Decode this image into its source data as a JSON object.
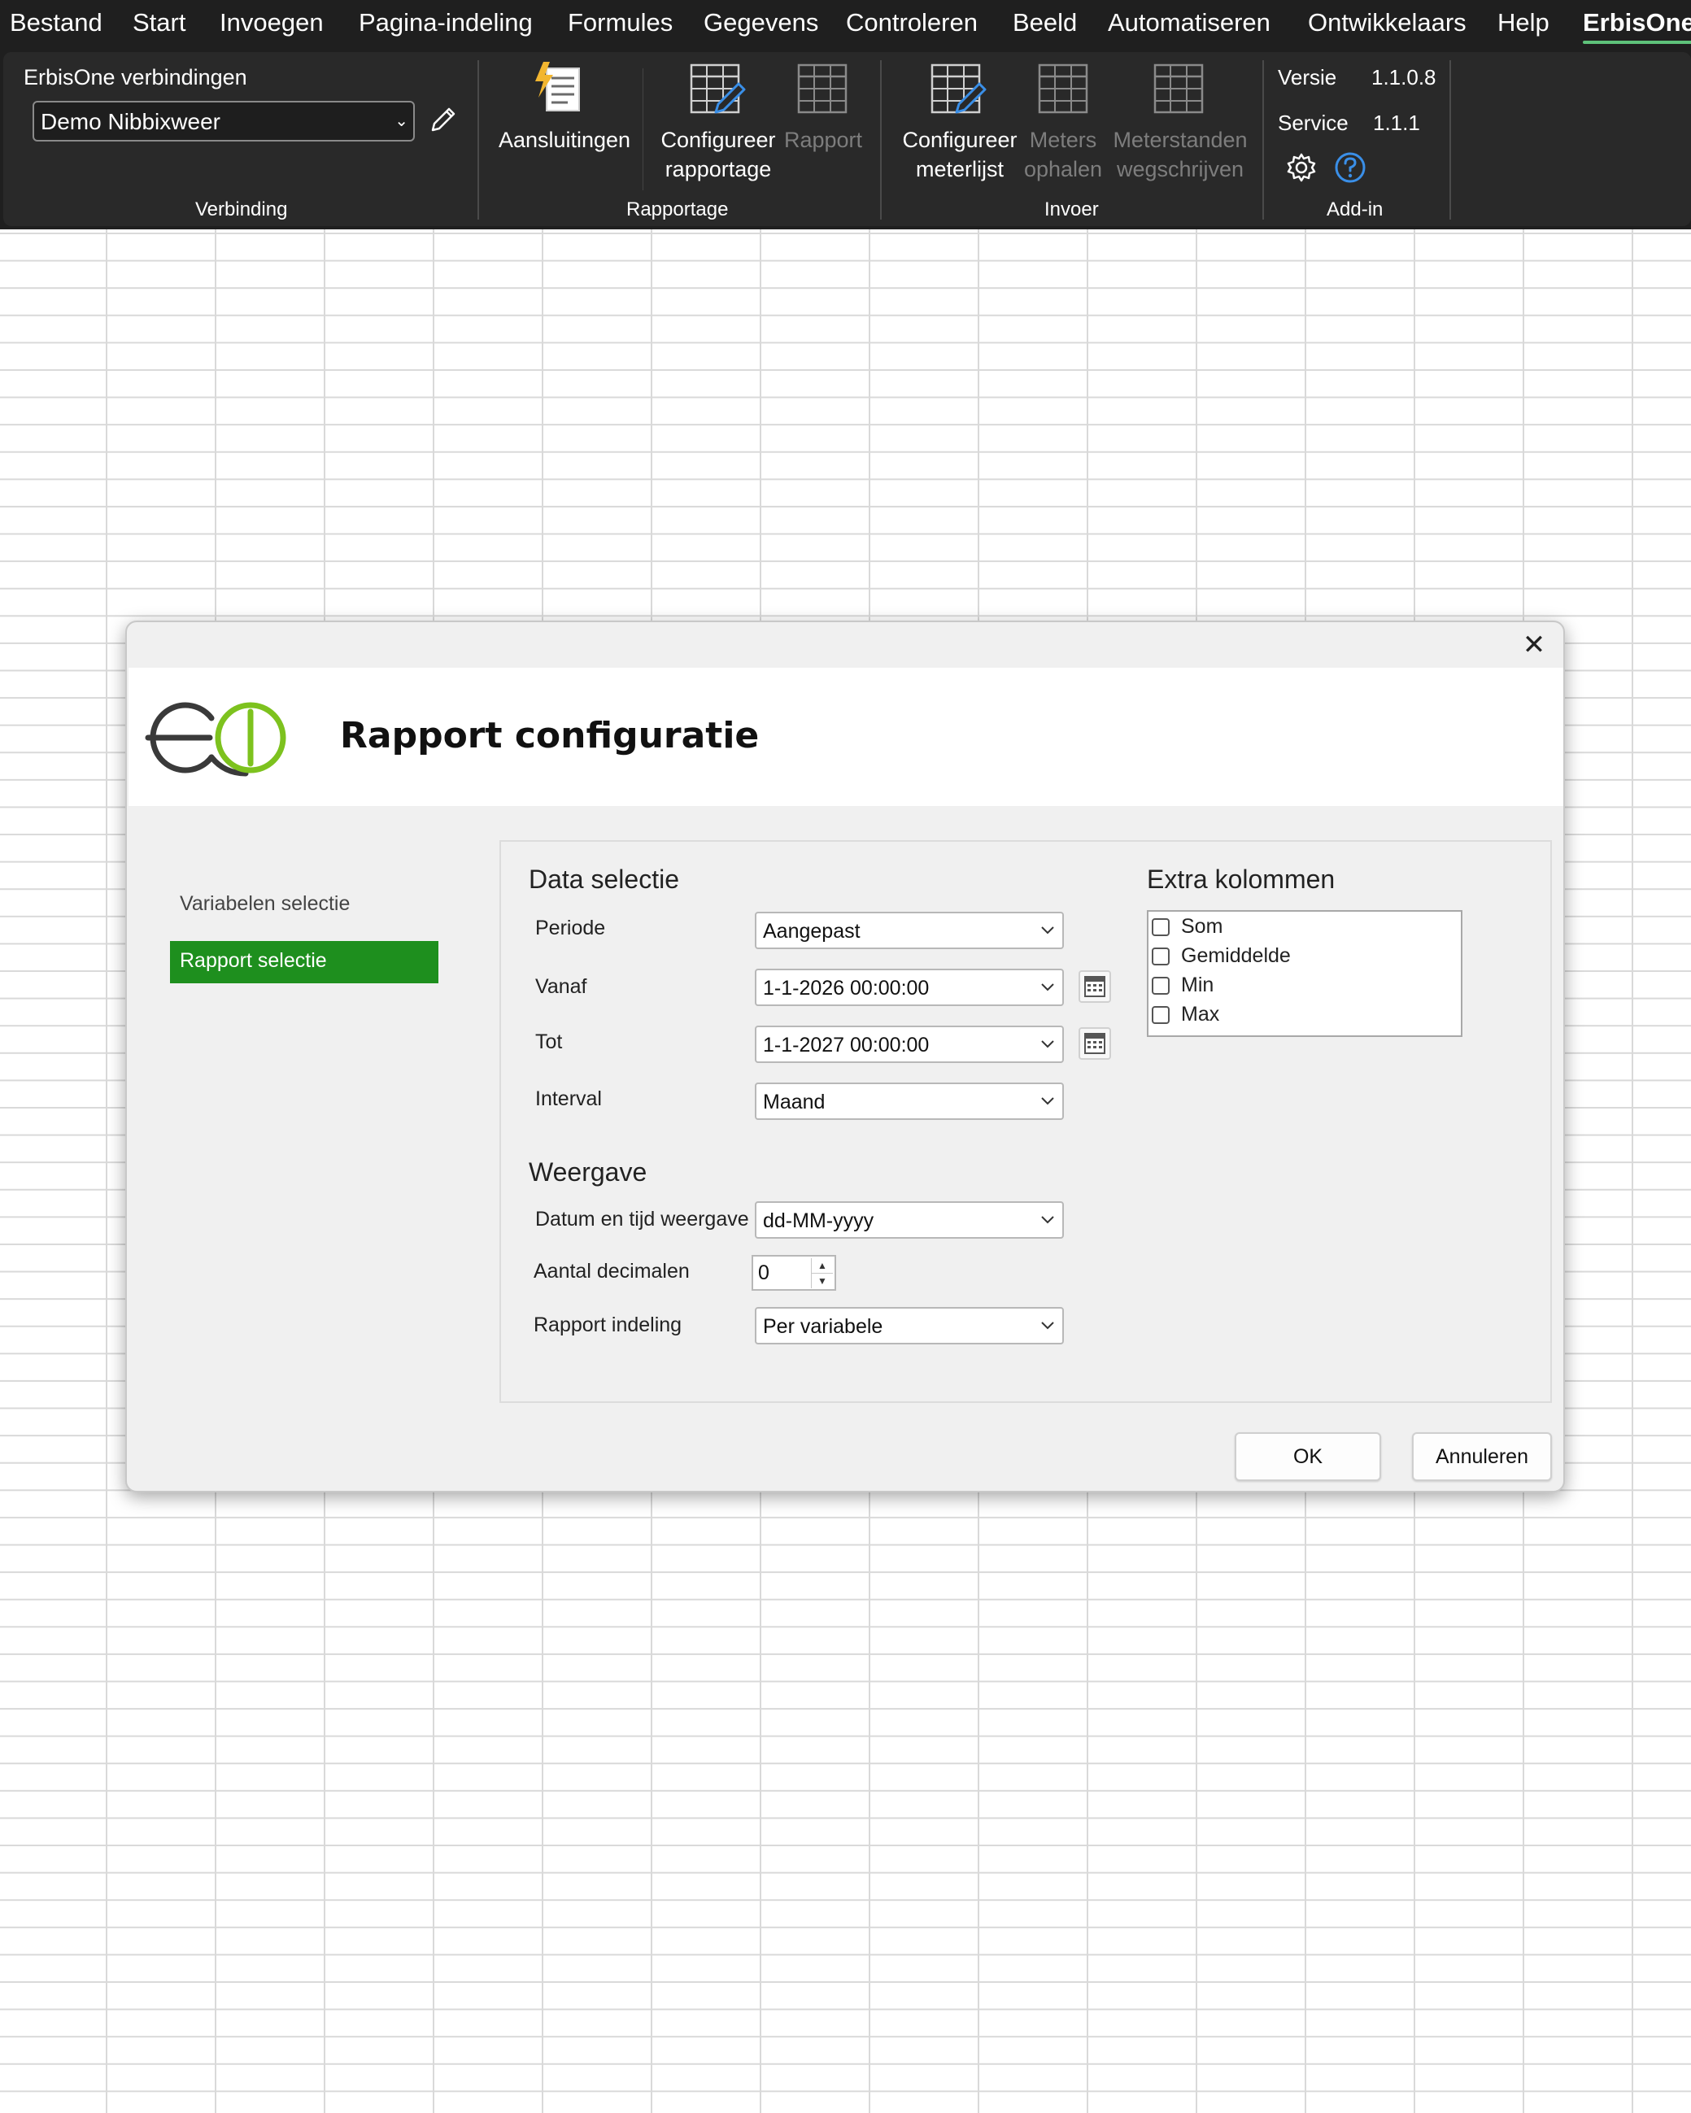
{
  "menu": {
    "items": [
      "Bestand",
      "Start",
      "Invoegen",
      "Pagina-indeling",
      "Formules",
      "Gegevens",
      "Controleren",
      "Beeld",
      "Automatiseren",
      "Ontwikkelaars",
      "Help",
      "ErbisOne"
    ],
    "active": "ErbisOne"
  },
  "ribbon": {
    "verbinding": {
      "heading": "ErbisOne verbindingen",
      "connection_value": "Demo Nibbixweer",
      "group_label": "Verbinding"
    },
    "rapportage": {
      "aansluitingen": "Aansluitingen",
      "configureer_rapportage": "Configureer\nrapportage",
      "rapport": "Rapport",
      "group_label": "Rapportage"
    },
    "invoer": {
      "configureer_meterlijst": "Configureer\nmeterlijst",
      "meters_ophalen": "Meters\nophalen",
      "meterstanden_wegschrijven": "Meterstanden\nwegschrijven",
      "group_label": "Invoer"
    },
    "addin": {
      "versie_label": "Versie",
      "versie_value": "1.1.0.8",
      "service_label": "Service",
      "service_value": "1.1.1",
      "group_label": "Add-in"
    },
    "colors": {
      "background": "#292929",
      "accent": "#5ec27a",
      "disabled_text": "#7d7d7d",
      "icon_blue": "#3a8fe8"
    }
  },
  "dialog": {
    "title": "Rapport configuratie",
    "close_symbol": "✕",
    "nav": {
      "items": [
        "Variabelen selectie",
        "Rapport selectie"
      ],
      "selected": "Rapport selectie",
      "selected_color": "#1e8f1e"
    },
    "data_selectie": {
      "title": "Data selectie",
      "periode_label": "Periode",
      "periode_value": "Aangepast",
      "vanaf_label": "Vanaf",
      "vanaf_value": "1-1-2026 00:00:00",
      "tot_label": "Tot",
      "tot_value": "1-1-2027 00:00:00",
      "interval_label": "Interval",
      "interval_value": "Maand"
    },
    "weergave": {
      "title": "Weergave",
      "datum_label": "Datum en tijd weergave",
      "datum_value": "dd-MM-yyyy",
      "decimalen_label": "Aantal decimalen",
      "decimalen_value": "0",
      "indeling_label": "Rapport indeling",
      "indeling_value": "Per variabele"
    },
    "extra_kolommen": {
      "title": "Extra kolommen",
      "options": [
        {
          "label": "Som",
          "checked": false
        },
        {
          "label": "Gemiddelde",
          "checked": false
        },
        {
          "label": "Min",
          "checked": false
        },
        {
          "label": "Max",
          "checked": false
        }
      ]
    },
    "buttons": {
      "ok": "OK",
      "cancel": "Annuleren"
    },
    "logo_colors": {
      "dark": "#3a3a3a",
      "green": "#7dc21e"
    }
  }
}
